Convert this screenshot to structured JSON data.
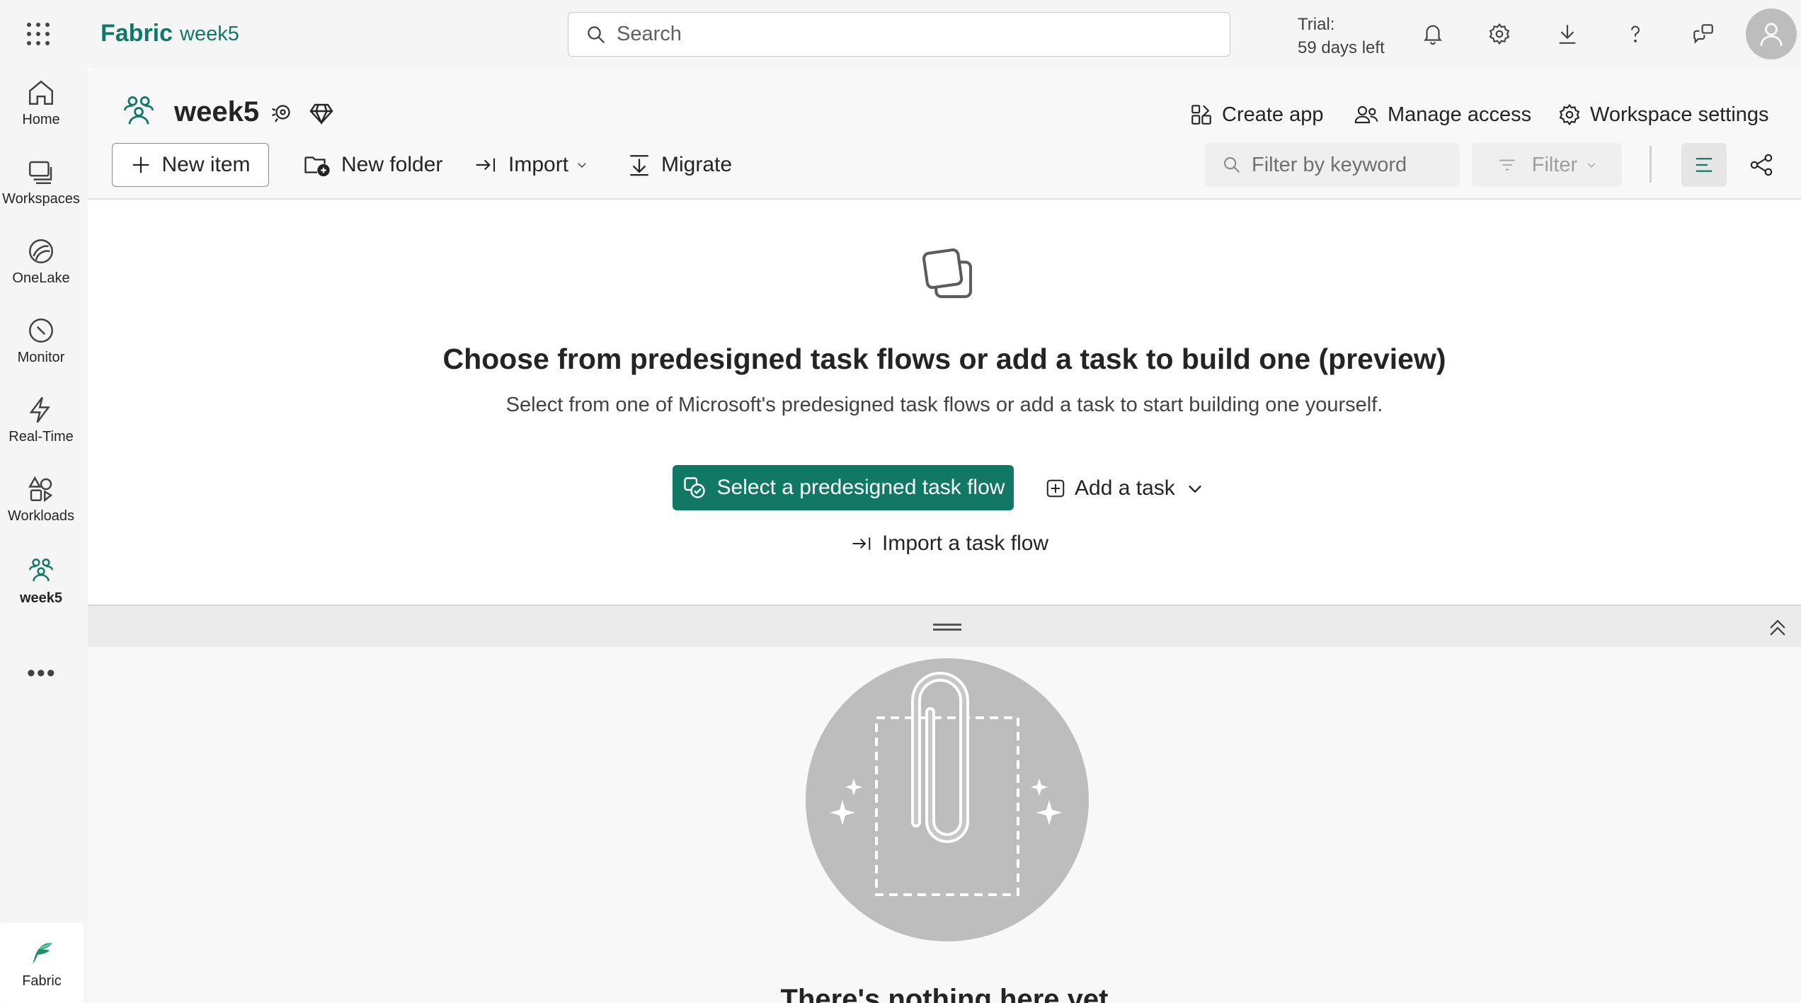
{
  "topbar": {
    "brand": "Fabric",
    "breadcrumb": "week5",
    "search_placeholder": "Search",
    "trial_label": "Trial:",
    "trial_days": "59 days left"
  },
  "rail": {
    "items": [
      {
        "label": "Home",
        "icon": "home-icon"
      },
      {
        "label": "Workspaces",
        "icon": "workspaces-icon"
      },
      {
        "label": "OneLake",
        "icon": "onelake-icon"
      },
      {
        "label": "Monitor",
        "icon": "monitor-icon"
      },
      {
        "label": "Real-Time",
        "icon": "real-time-icon"
      },
      {
        "label": "Workloads",
        "icon": "workloads-icon"
      },
      {
        "label": "week5",
        "icon": "workspace-icon"
      }
    ],
    "more": "•••",
    "footer_label": "Fabric"
  },
  "workspace": {
    "title": "week5",
    "actions": {
      "create_app": "Create app",
      "manage_access": "Manage access",
      "workspace_settings": "Workspace settings"
    }
  },
  "toolbar": {
    "new_item": "New item",
    "new_folder": "New folder",
    "import": "Import",
    "migrate": "Migrate",
    "filter_placeholder": "Filter by keyword",
    "filter": "Filter"
  },
  "taskflow": {
    "title": "Choose from predesigned task flows or add a task to build one (preview)",
    "subtitle": "Select from one of Microsoft's predesigned task flows or add a task to start building one yourself.",
    "primary_button": "Select a predesigned task flow",
    "add_task": "Add a task",
    "import_flow": "Import a task flow"
  },
  "items": {
    "empty_title": "There's nothing here yet"
  },
  "colors": {
    "brand": "#117865",
    "rail_bg": "#f5f5f5",
    "primary": "#117865"
  }
}
